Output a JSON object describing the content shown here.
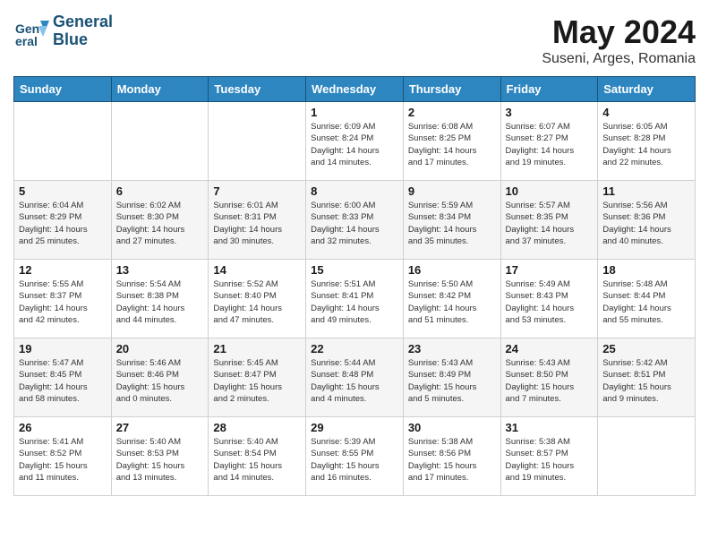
{
  "header": {
    "logo_line1": "General",
    "logo_line2": "Blue",
    "month_year": "May 2024",
    "location": "Suseni, Arges, Romania"
  },
  "weekdays": [
    "Sunday",
    "Monday",
    "Tuesday",
    "Wednesday",
    "Thursday",
    "Friday",
    "Saturday"
  ],
  "weeks": [
    [
      {
        "day": "",
        "info": ""
      },
      {
        "day": "",
        "info": ""
      },
      {
        "day": "",
        "info": ""
      },
      {
        "day": "1",
        "info": "Sunrise: 6:09 AM\nSunset: 8:24 PM\nDaylight: 14 hours\nand 14 minutes."
      },
      {
        "day": "2",
        "info": "Sunrise: 6:08 AM\nSunset: 8:25 PM\nDaylight: 14 hours\nand 17 minutes."
      },
      {
        "day": "3",
        "info": "Sunrise: 6:07 AM\nSunset: 8:27 PM\nDaylight: 14 hours\nand 19 minutes."
      },
      {
        "day": "4",
        "info": "Sunrise: 6:05 AM\nSunset: 8:28 PM\nDaylight: 14 hours\nand 22 minutes."
      }
    ],
    [
      {
        "day": "5",
        "info": "Sunrise: 6:04 AM\nSunset: 8:29 PM\nDaylight: 14 hours\nand 25 minutes."
      },
      {
        "day": "6",
        "info": "Sunrise: 6:02 AM\nSunset: 8:30 PM\nDaylight: 14 hours\nand 27 minutes."
      },
      {
        "day": "7",
        "info": "Sunrise: 6:01 AM\nSunset: 8:31 PM\nDaylight: 14 hours\nand 30 minutes."
      },
      {
        "day": "8",
        "info": "Sunrise: 6:00 AM\nSunset: 8:33 PM\nDaylight: 14 hours\nand 32 minutes."
      },
      {
        "day": "9",
        "info": "Sunrise: 5:59 AM\nSunset: 8:34 PM\nDaylight: 14 hours\nand 35 minutes."
      },
      {
        "day": "10",
        "info": "Sunrise: 5:57 AM\nSunset: 8:35 PM\nDaylight: 14 hours\nand 37 minutes."
      },
      {
        "day": "11",
        "info": "Sunrise: 5:56 AM\nSunset: 8:36 PM\nDaylight: 14 hours\nand 40 minutes."
      }
    ],
    [
      {
        "day": "12",
        "info": "Sunrise: 5:55 AM\nSunset: 8:37 PM\nDaylight: 14 hours\nand 42 minutes."
      },
      {
        "day": "13",
        "info": "Sunrise: 5:54 AM\nSunset: 8:38 PM\nDaylight: 14 hours\nand 44 minutes."
      },
      {
        "day": "14",
        "info": "Sunrise: 5:52 AM\nSunset: 8:40 PM\nDaylight: 14 hours\nand 47 minutes."
      },
      {
        "day": "15",
        "info": "Sunrise: 5:51 AM\nSunset: 8:41 PM\nDaylight: 14 hours\nand 49 minutes."
      },
      {
        "day": "16",
        "info": "Sunrise: 5:50 AM\nSunset: 8:42 PM\nDaylight: 14 hours\nand 51 minutes."
      },
      {
        "day": "17",
        "info": "Sunrise: 5:49 AM\nSunset: 8:43 PM\nDaylight: 14 hours\nand 53 minutes."
      },
      {
        "day": "18",
        "info": "Sunrise: 5:48 AM\nSunset: 8:44 PM\nDaylight: 14 hours\nand 55 minutes."
      }
    ],
    [
      {
        "day": "19",
        "info": "Sunrise: 5:47 AM\nSunset: 8:45 PM\nDaylight: 14 hours\nand 58 minutes."
      },
      {
        "day": "20",
        "info": "Sunrise: 5:46 AM\nSunset: 8:46 PM\nDaylight: 15 hours\nand 0 minutes."
      },
      {
        "day": "21",
        "info": "Sunrise: 5:45 AM\nSunset: 8:47 PM\nDaylight: 15 hours\nand 2 minutes."
      },
      {
        "day": "22",
        "info": "Sunrise: 5:44 AM\nSunset: 8:48 PM\nDaylight: 15 hours\nand 4 minutes."
      },
      {
        "day": "23",
        "info": "Sunrise: 5:43 AM\nSunset: 8:49 PM\nDaylight: 15 hours\nand 5 minutes."
      },
      {
        "day": "24",
        "info": "Sunrise: 5:43 AM\nSunset: 8:50 PM\nDaylight: 15 hours\nand 7 minutes."
      },
      {
        "day": "25",
        "info": "Sunrise: 5:42 AM\nSunset: 8:51 PM\nDaylight: 15 hours\nand 9 minutes."
      }
    ],
    [
      {
        "day": "26",
        "info": "Sunrise: 5:41 AM\nSunset: 8:52 PM\nDaylight: 15 hours\nand 11 minutes."
      },
      {
        "day": "27",
        "info": "Sunrise: 5:40 AM\nSunset: 8:53 PM\nDaylight: 15 hours\nand 13 minutes."
      },
      {
        "day": "28",
        "info": "Sunrise: 5:40 AM\nSunset: 8:54 PM\nDaylight: 15 hours\nand 14 minutes."
      },
      {
        "day": "29",
        "info": "Sunrise: 5:39 AM\nSunset: 8:55 PM\nDaylight: 15 hours\nand 16 minutes."
      },
      {
        "day": "30",
        "info": "Sunrise: 5:38 AM\nSunset: 8:56 PM\nDaylight: 15 hours\nand 17 minutes."
      },
      {
        "day": "31",
        "info": "Sunrise: 5:38 AM\nSunset: 8:57 PM\nDaylight: 15 hours\nand 19 minutes."
      },
      {
        "day": "",
        "info": ""
      }
    ]
  ]
}
